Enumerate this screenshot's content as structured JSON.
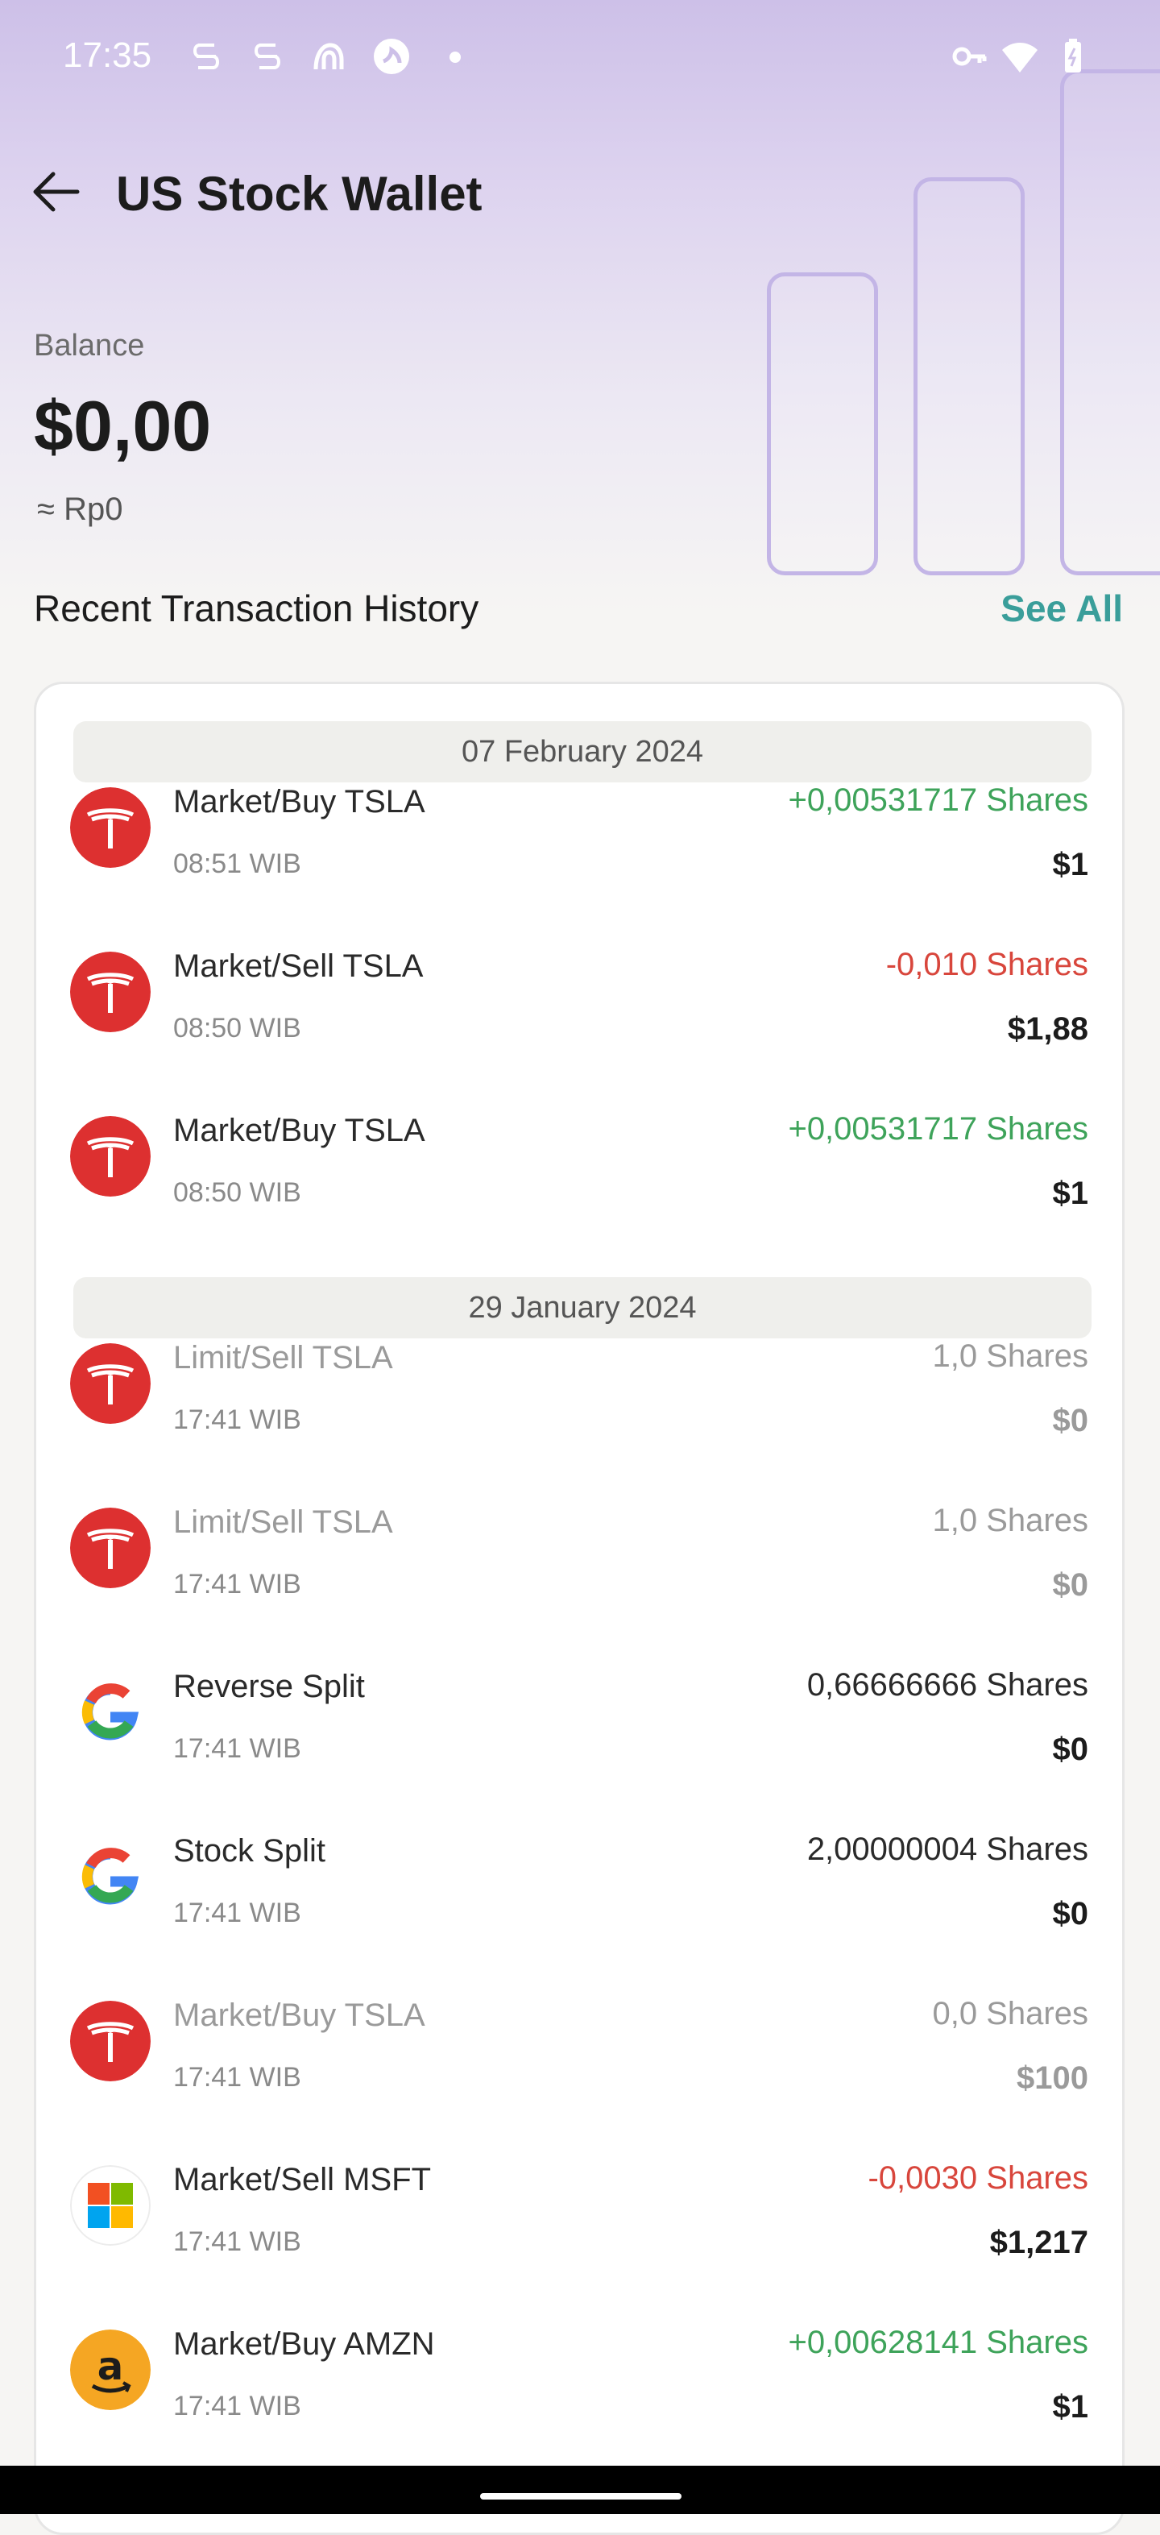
{
  "status": {
    "time": "17:35"
  },
  "header": {
    "title": "US Stock Wallet"
  },
  "balance": {
    "label": "Balance",
    "value": "$0,00",
    "approx": "≈ Rp0"
  },
  "section": {
    "title": "Recent Transaction History",
    "see_all": "See All"
  },
  "groups": [
    {
      "date": "07 February 2024"
    },
    {
      "date": "29 January 2024"
    }
  ],
  "transactions": [
    {
      "logo": "tesla-icon",
      "name": "Market/Buy TSLA",
      "time": "08:51 WIB",
      "shares": "+0,00531717 Shares",
      "amount": "$1",
      "status": "positive"
    },
    {
      "logo": "tesla-icon",
      "name": "Market/Sell TSLA",
      "time": "08:50 WIB",
      "shares": "-0,010 Shares",
      "amount": "$1,88",
      "status": "negative"
    },
    {
      "logo": "tesla-icon",
      "name": "Market/Buy TSLA",
      "time": "08:50 WIB",
      "shares": "+0,00531717 Shares",
      "amount": "$1",
      "status": "positive"
    },
    {
      "logo": "tesla-icon",
      "name": "Limit/Sell TSLA",
      "time": "17:41 WIB",
      "shares": "1,0 Shares",
      "amount": "$0",
      "status": "muted"
    },
    {
      "logo": "tesla-icon",
      "name": "Limit/Sell TSLA",
      "time": "17:41 WIB",
      "shares": "1,0 Shares",
      "amount": "$0",
      "status": "muted"
    },
    {
      "logo": "google-icon",
      "name": "Reverse Split",
      "time": "17:41 WIB",
      "shares": "0,66666666 Shares",
      "amount": "$0",
      "status": "neutral"
    },
    {
      "logo": "google-icon",
      "name": "Stock Split",
      "time": "17:41 WIB",
      "shares": "2,00000004 Shares",
      "amount": "$0",
      "status": "neutral"
    },
    {
      "logo": "tesla-icon",
      "name": "Market/Buy TSLA",
      "time": "17:41 WIB",
      "shares": "0,0 Shares",
      "amount": "$100",
      "status": "muted"
    },
    {
      "logo": "microsoft-icon",
      "name": "Market/Sell MSFT",
      "time": "17:41 WIB",
      "shares": "-0,0030 Shares",
      "amount": "$1,217",
      "status": "negative"
    },
    {
      "logo": "amazon-icon",
      "name": "Market/Buy AMZN",
      "time": "17:41 WIB",
      "shares": "+0,00628141 Shares",
      "amount": "$1",
      "status": "positive"
    }
  ],
  "colors": {
    "positive": "#3ea35a",
    "negative": "#d8463c",
    "accent": "#3a9e9a"
  }
}
